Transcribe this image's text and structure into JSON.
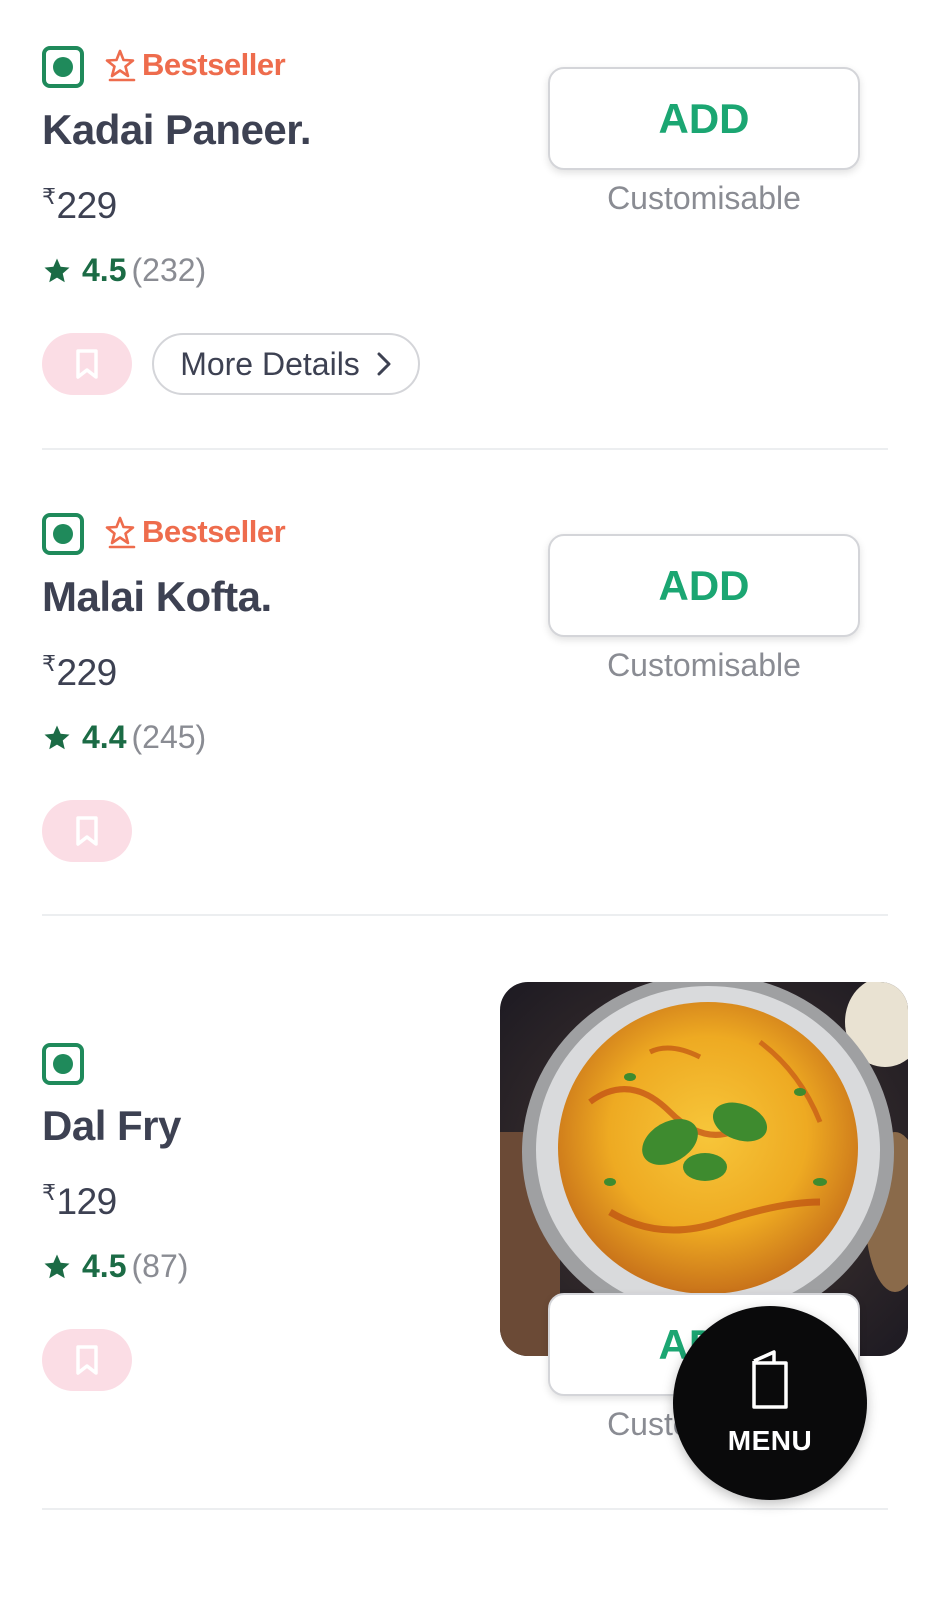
{
  "items": [
    {
      "badge": "Bestseller",
      "name": "Kadai Paneer.",
      "currency": "₹",
      "price": "229",
      "rating": "4.5",
      "rating_count": "(232)",
      "more_details": "More Details",
      "add_label": "ADD",
      "customisable": "Customisable"
    },
    {
      "badge": "Bestseller",
      "name": "Malai Kofta.",
      "currency": "₹",
      "price": "229",
      "rating": "4.4",
      "rating_count": "(245)",
      "add_label": "ADD",
      "customisable": "Customisable"
    },
    {
      "name": "Dal Fry",
      "currency": "₹",
      "price": "129",
      "rating": "4.5",
      "rating_count": "(87)",
      "add_label": "ADD",
      "customisable": "Customisable"
    }
  ],
  "menu_fab": {
    "label": "MENU",
    "icon": "menu-book-icon"
  },
  "colors": {
    "veg_green": "#1f8a5b",
    "bestseller": "#ee6c4d",
    "add_green": "#1ba672",
    "rating_green": "#1b6b45",
    "bookmark_bg": "#fbdde5"
  }
}
